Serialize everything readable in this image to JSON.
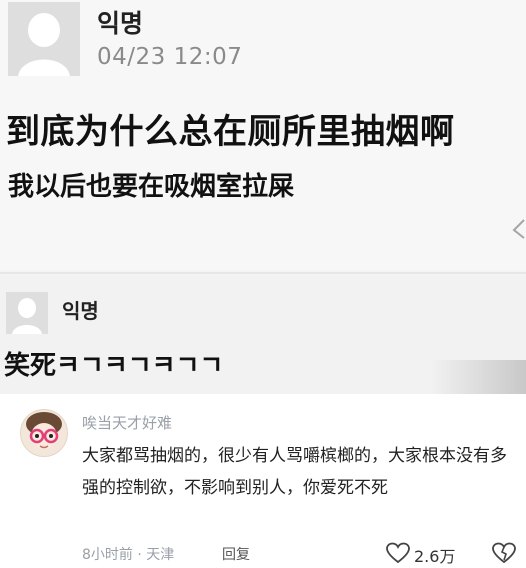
{
  "post": {
    "author": "익명",
    "time": "04/23 12:07",
    "line1": "到底为什么总在厕所里抽烟啊",
    "line2": "我以后也要在吸烟室拉屎"
  },
  "reply": {
    "author": "익명",
    "text": "笑死ㅋㄱㅋㄱㅋㄱㄱ"
  },
  "comment": {
    "username": "唉当天才好难",
    "text": "大家都骂抽烟的，很少有人骂嚼槟榔的，大家根本没有多强的控制欲，不影响到别人，你爱死不死",
    "meta": "8小时前 · 天津",
    "reply_label": "回复",
    "like_count": "2.6万"
  },
  "icons": {
    "like": "heart-icon",
    "dislike": "broken-heart-icon",
    "share": "share-icon"
  }
}
